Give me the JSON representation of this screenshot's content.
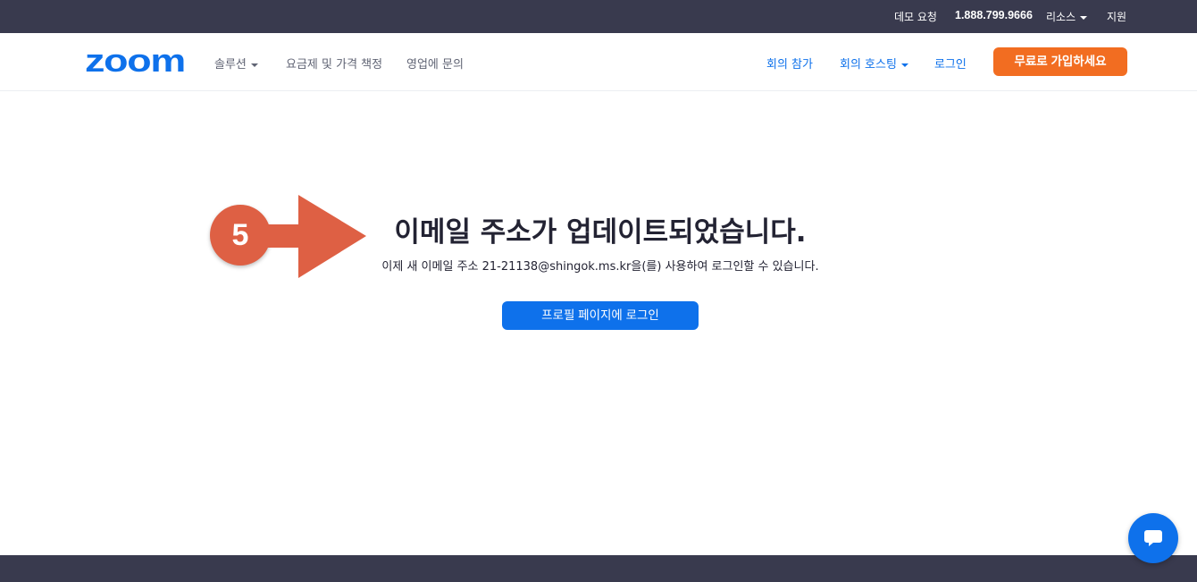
{
  "topbar": {
    "demo": "데모 요청",
    "phone": "1.888.799.9666",
    "resources": "리소스",
    "support": "지원"
  },
  "nav": {
    "logo_text": "zoom",
    "solutions": "솔루션",
    "pricing": "요금제 및 가격 책정",
    "contact_sales": "영업에 문의",
    "join_meeting": "회의 참가",
    "host_meeting": "회의 호스팅",
    "sign_in": "로그인",
    "signup": "무료로 가입하세요"
  },
  "annotation": {
    "step_number": "5"
  },
  "main": {
    "headline": "이메일 주소가 업데이트되었습니다.",
    "message": "이제 새 이메일 주소 21-21138@shingok.ms.kr을(를) 사용하여 로그인할 수 있습니다.",
    "profile_button": "프로필 페이지에 로그인"
  },
  "colors": {
    "topbar_bg": "#393a4e",
    "brand_blue": "#0e71eb",
    "signup_orange": "#f26d21",
    "annotation_red": "#de6044"
  },
  "icons": {
    "chat": "chat-bubble-icon",
    "caret": "caret-down-icon"
  }
}
